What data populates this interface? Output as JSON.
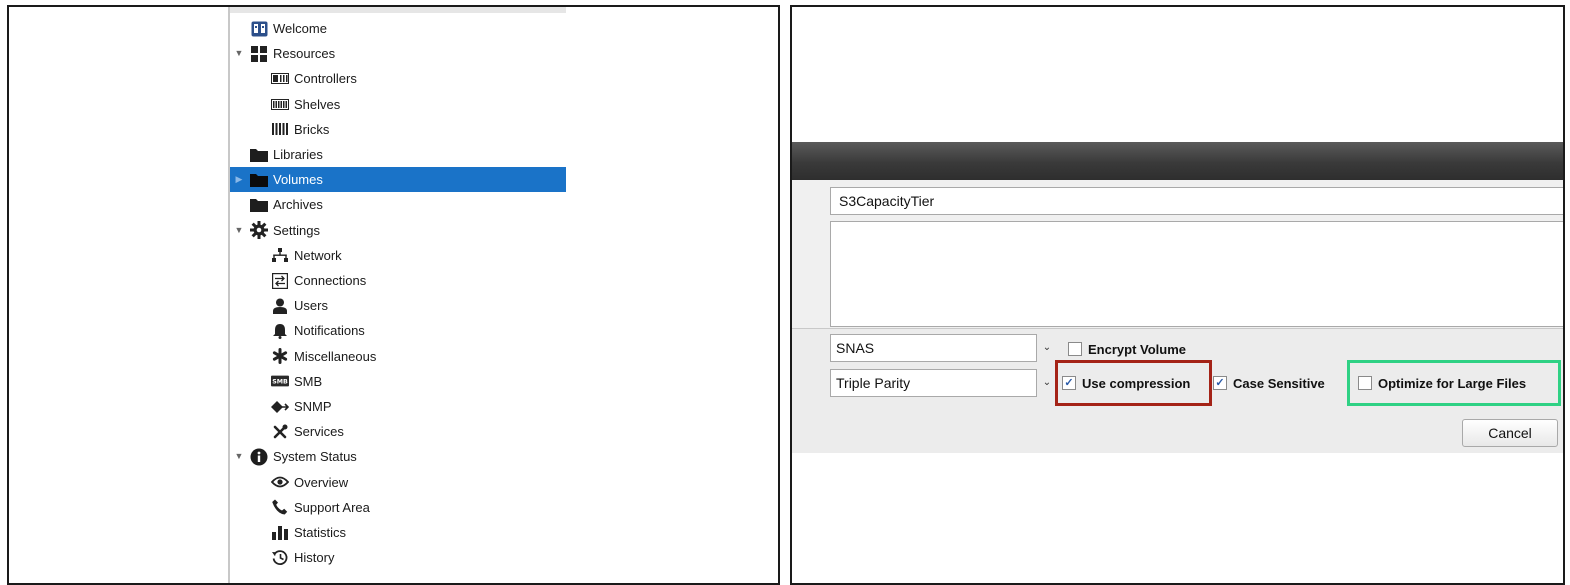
{
  "tree": {
    "items": [
      {
        "label": "Welcome",
        "icon": "welcome-icon",
        "level": 0,
        "expandable": false,
        "selected": false
      },
      {
        "label": "Resources",
        "icon": "resources-icon",
        "level": 0,
        "expandable": true,
        "selected": false
      },
      {
        "label": "Controllers",
        "icon": "controllers-icon",
        "level": 1,
        "expandable": false,
        "selected": false
      },
      {
        "label": "Shelves",
        "icon": "shelves-icon",
        "level": 1,
        "expandable": false,
        "selected": false
      },
      {
        "label": "Bricks",
        "icon": "bricks-icon",
        "level": 1,
        "expandable": false,
        "selected": false
      },
      {
        "label": "Libraries",
        "icon": "folder-icon",
        "level": 0,
        "expandable": false,
        "selected": false
      },
      {
        "label": "Volumes",
        "icon": "folder-icon",
        "level": 0,
        "expandable": true,
        "selected": true
      },
      {
        "label": "Archives",
        "icon": "folder-icon",
        "level": 0,
        "expandable": false,
        "selected": false
      },
      {
        "label": "Settings",
        "icon": "gear-icon",
        "level": 0,
        "expandable": true,
        "selected": false
      },
      {
        "label": "Network",
        "icon": "network-icon",
        "level": 1,
        "expandable": false,
        "selected": false
      },
      {
        "label": "Connections",
        "icon": "connections-icon",
        "level": 1,
        "expandable": false,
        "selected": false
      },
      {
        "label": "Users",
        "icon": "user-icon",
        "level": 1,
        "expandable": false,
        "selected": false
      },
      {
        "label": "Notifications",
        "icon": "bell-icon",
        "level": 1,
        "expandable": false,
        "selected": false
      },
      {
        "label": "Miscellaneous",
        "icon": "asterisk-icon",
        "level": 1,
        "expandable": false,
        "selected": false
      },
      {
        "label": "SMB",
        "icon": "smb-icon",
        "level": 1,
        "expandable": false,
        "selected": false
      },
      {
        "label": "SNMP",
        "icon": "snmp-icon",
        "level": 1,
        "expandable": false,
        "selected": false
      },
      {
        "label": "Services",
        "icon": "tools-icon",
        "level": 1,
        "expandable": false,
        "selected": false
      },
      {
        "label": "System Status",
        "icon": "info-icon",
        "level": 0,
        "expandable": true,
        "selected": false
      },
      {
        "label": "Overview",
        "icon": "eye-icon",
        "level": 1,
        "expandable": false,
        "selected": false
      },
      {
        "label": "Support Area",
        "icon": "phone-icon",
        "level": 1,
        "expandable": false,
        "selected": false
      },
      {
        "label": "Statistics",
        "icon": "bar-chart-icon",
        "level": 1,
        "expandable": false,
        "selected": false
      },
      {
        "label": "History",
        "icon": "history-icon",
        "level": 1,
        "expandable": false,
        "selected": false
      }
    ],
    "selected_color": "#1a73c8"
  },
  "dialog": {
    "name_value": "S3CapacityTier",
    "description_value": "",
    "type_select": "SNAS",
    "parity_select": "Triple Parity",
    "encrypt_label": "Encrypt Volume",
    "encrypt_checked": false,
    "compression_label": "Use compression",
    "compression_checked": true,
    "case_label": "Case Sensitive",
    "case_checked": true,
    "optimize_label": "Optimize for Large Files",
    "optimize_checked": false,
    "cancel_label": "Cancel"
  },
  "annotations": {
    "red_box_color": "#a42317",
    "green_box_color": "#2fd184"
  }
}
